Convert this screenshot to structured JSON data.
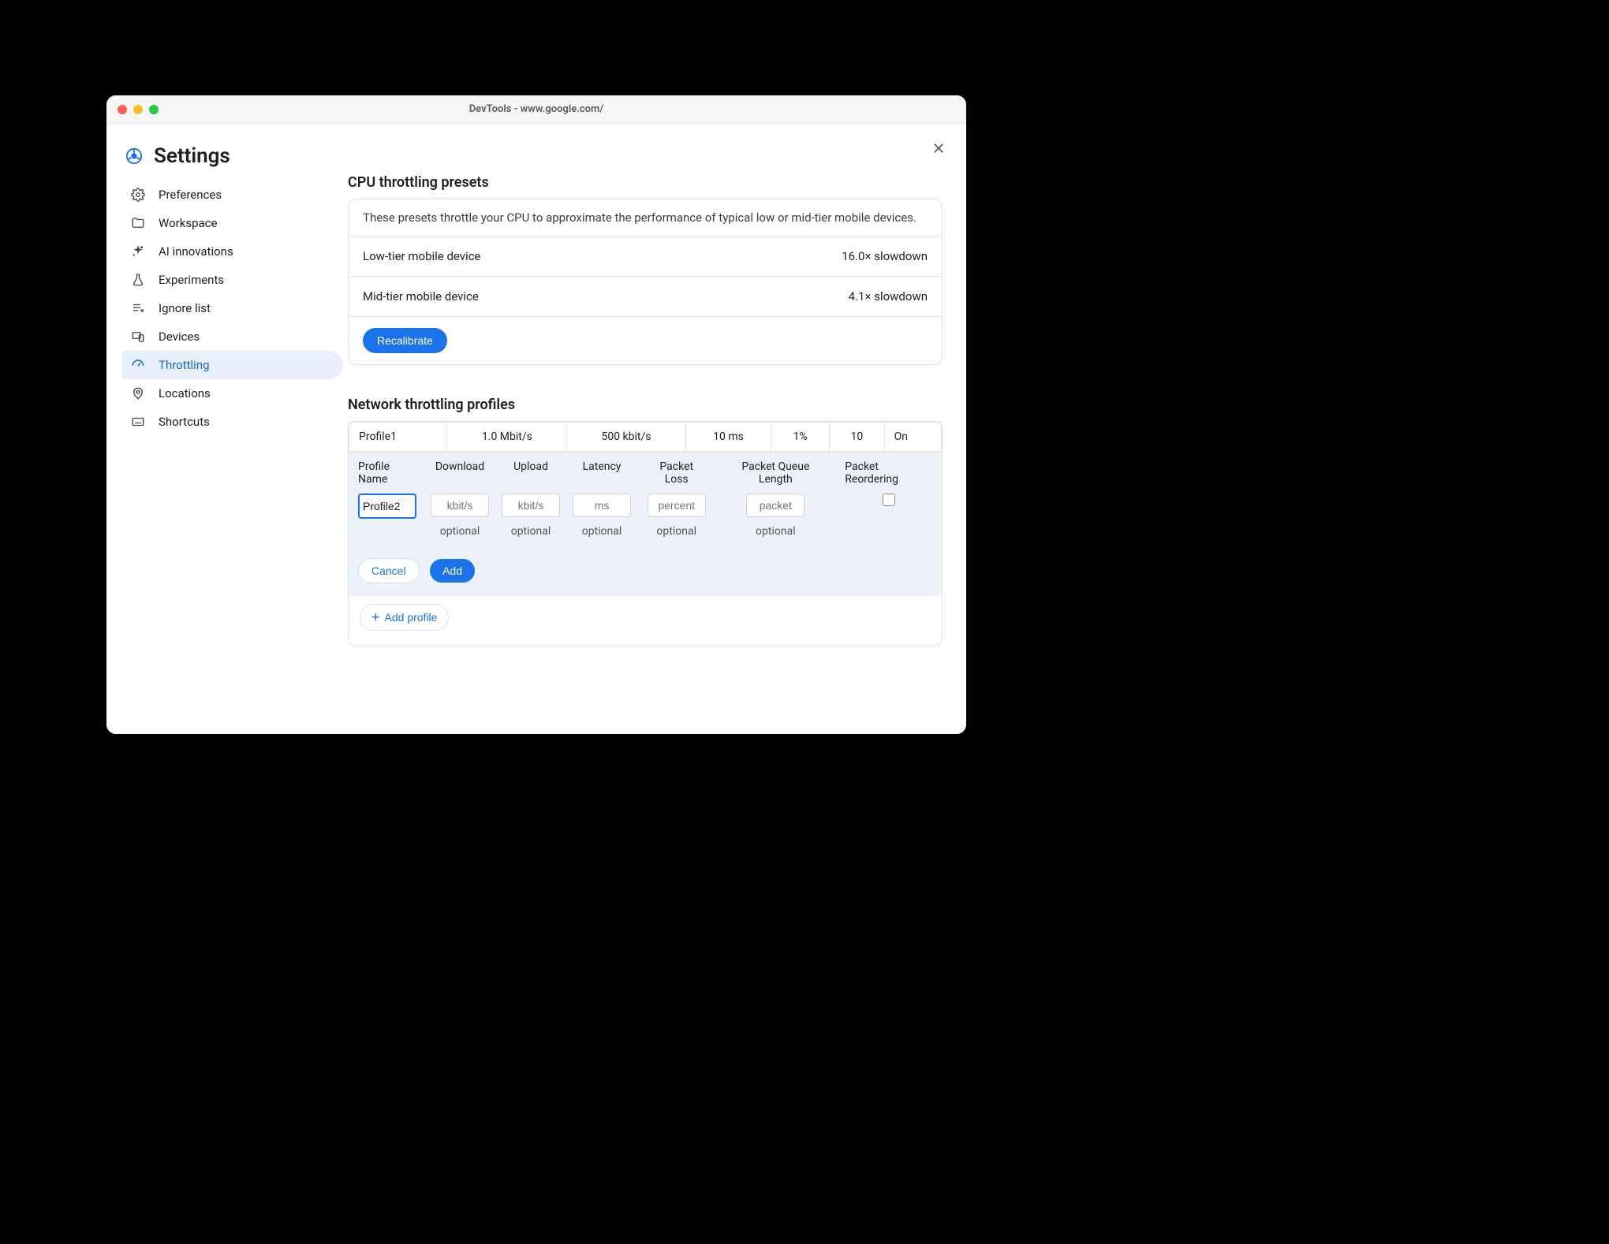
{
  "window": {
    "title": "DevTools - www.google.com/"
  },
  "settings": {
    "title": "Settings"
  },
  "sidebar": {
    "items": [
      {
        "label": "Preferences"
      },
      {
        "label": "Workspace"
      },
      {
        "label": "AI innovations"
      },
      {
        "label": "Experiments"
      },
      {
        "label": "Ignore list"
      },
      {
        "label": "Devices"
      },
      {
        "label": "Throttling"
      },
      {
        "label": "Locations"
      },
      {
        "label": "Shortcuts"
      }
    ]
  },
  "cpu": {
    "section_title": "CPU throttling presets",
    "description": "These presets throttle your CPU to approximate the performance of typical low or mid-tier mobile devices.",
    "presets": [
      {
        "name": "Low-tier mobile device",
        "value": "16.0× slowdown"
      },
      {
        "name": "Mid-tier mobile device",
        "value": "4.1× slowdown"
      }
    ],
    "recalibrate": "Recalibrate"
  },
  "network": {
    "section_title": "Network throttling profiles",
    "existing": {
      "name": "Profile1",
      "download": "1.0 Mbit/s",
      "upload": "500 kbit/s",
      "latency": "10 ms",
      "loss": "1%",
      "queue": "10",
      "reorder": "On"
    },
    "headers": {
      "name": "Profile Name",
      "download": "Download",
      "upload": "Upload",
      "latency": "Latency",
      "loss": "Packet Loss",
      "queue": "Packet Queue Length",
      "reorder": "Packet Reordering"
    },
    "edit": {
      "name_value": "Profile2",
      "placeholders": {
        "download": "kbit/s",
        "upload": "kbit/s",
        "latency": "ms",
        "loss": "percent",
        "queue": "packet"
      },
      "optional": "optional",
      "cancel": "Cancel",
      "add": "Add"
    },
    "add_profile": "Add profile"
  }
}
